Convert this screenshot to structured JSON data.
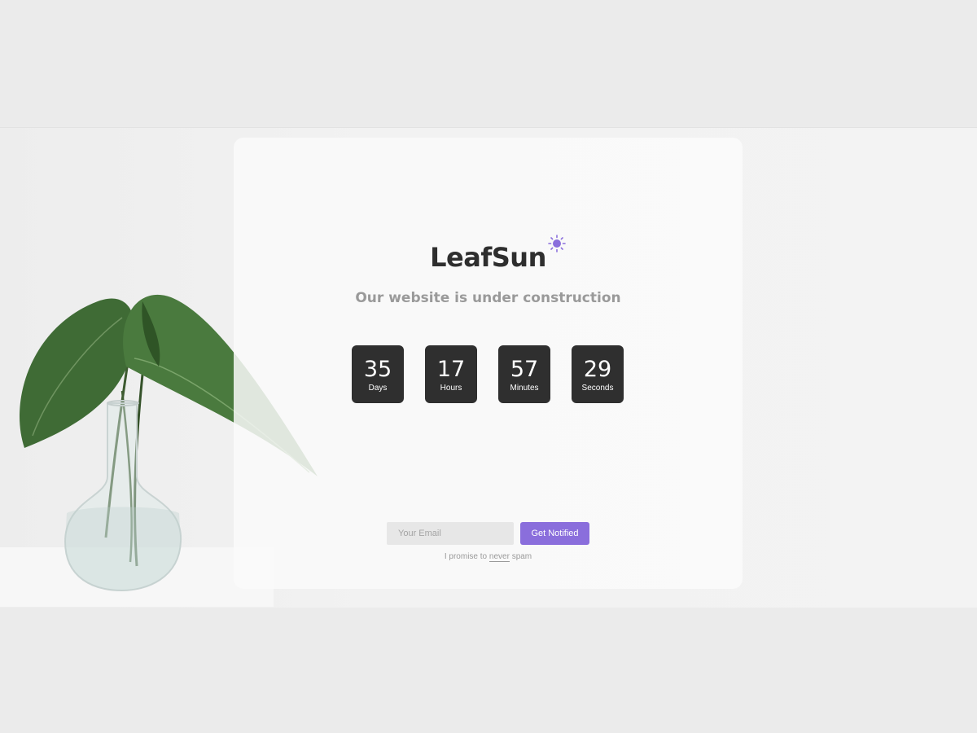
{
  "brand": {
    "name": "LeafSun",
    "icon": "sun-icon",
    "accent": "#8a6edc"
  },
  "tagline": "Our website is under construction",
  "countdown": [
    {
      "value": "35",
      "label": "Days"
    },
    {
      "value": "17",
      "label": "Hours"
    },
    {
      "value": "57",
      "label": "Minutes"
    },
    {
      "value": "29",
      "label": "Seconds"
    }
  ],
  "signup": {
    "email_placeholder": "Your Email",
    "button_label": "Get Notified",
    "promise_before": "I promise to",
    "promise_emphasis": "never",
    "promise_after": "spam"
  }
}
